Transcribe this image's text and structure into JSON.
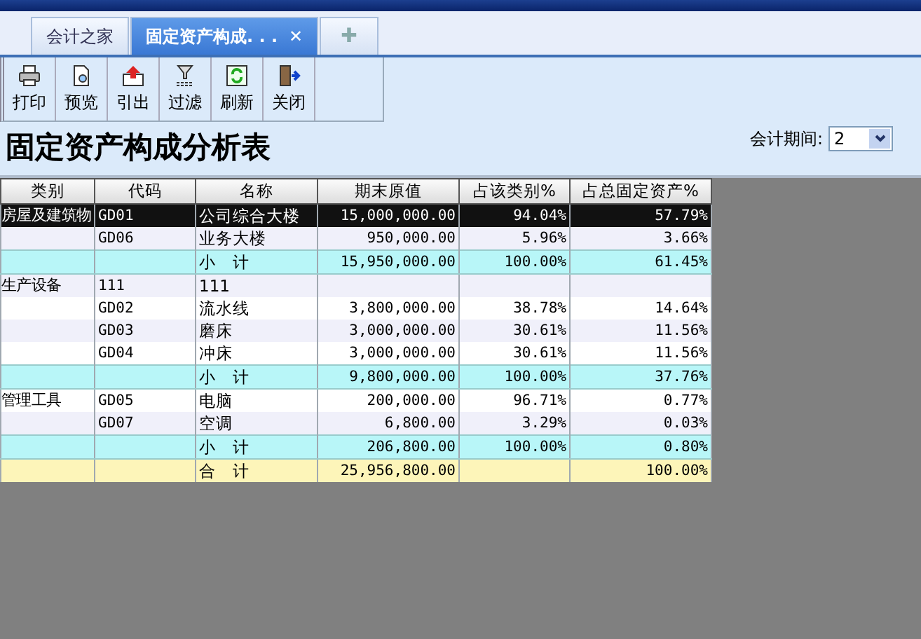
{
  "tabs": [
    {
      "label": "会计之家",
      "selected": false
    },
    {
      "label": "固定资产构成. . .",
      "selected": true,
      "close": "✕"
    }
  ],
  "add_tab": "✚",
  "toolbar": [
    {
      "label": "打印"
    },
    {
      "label": "预览"
    },
    {
      "label": "引出"
    },
    {
      "label": "过滤"
    },
    {
      "label": "刷新"
    },
    {
      "label": "关闭"
    }
  ],
  "report": {
    "title": "固定资产构成分析表",
    "period_label": "会计期间:",
    "period_value": "2"
  },
  "table": {
    "columns": [
      "类别",
      "代码",
      "名称",
      "期末原值",
      "占该类别%",
      "占总固定资产%"
    ],
    "rows": [
      {
        "kind": "item",
        "selected": true,
        "cells": [
          "房屋及建筑物",
          "GD01",
          "公司综合大楼",
          "15,000,000.00",
          "94.04%",
          "57.79%"
        ]
      },
      {
        "kind": "item",
        "selected": false,
        "cells": [
          "",
          "GD06",
          "业务大楼",
          "950,000.00",
          "5.96%",
          "3.66%"
        ]
      },
      {
        "kind": "subtotal",
        "selected": false,
        "cells": [
          "",
          "",
          "小　计",
          "15,950,000.00",
          "100.00%",
          "61.45%"
        ]
      },
      {
        "kind": "item",
        "selected": false,
        "cells": [
          "生产设备",
          "111",
          "111",
          "",
          "",
          ""
        ]
      },
      {
        "kind": "item",
        "selected": false,
        "cells": [
          "",
          "GD02",
          "流水线",
          "3,800,000.00",
          "38.78%",
          "14.64%"
        ]
      },
      {
        "kind": "item",
        "selected": false,
        "cells": [
          "",
          "GD03",
          "磨床",
          "3,000,000.00",
          "30.61%",
          "11.56%"
        ]
      },
      {
        "kind": "item",
        "selected": false,
        "cells": [
          "",
          "GD04",
          "冲床",
          "3,000,000.00",
          "30.61%",
          "11.56%"
        ]
      },
      {
        "kind": "subtotal",
        "selected": false,
        "cells": [
          "",
          "",
          "小　计",
          "9,800,000.00",
          "100.00%",
          "37.76%"
        ]
      },
      {
        "kind": "item",
        "selected": false,
        "cells": [
          "管理工具",
          "GD05",
          "电脑",
          "200,000.00",
          "96.71%",
          "0.77%"
        ]
      },
      {
        "kind": "item",
        "selected": false,
        "cells": [
          "",
          "GD07",
          "空调",
          "6,800.00",
          "3.29%",
          "0.03%"
        ]
      },
      {
        "kind": "subtotal",
        "selected": false,
        "cells": [
          "",
          "",
          "小　计",
          "206,800.00",
          "100.00%",
          "0.80%"
        ]
      },
      {
        "kind": "total",
        "selected": false,
        "cells": [
          "",
          "",
          "合　计",
          "25,956,800.00",
          "",
          "100.00%"
        ]
      }
    ]
  }
}
